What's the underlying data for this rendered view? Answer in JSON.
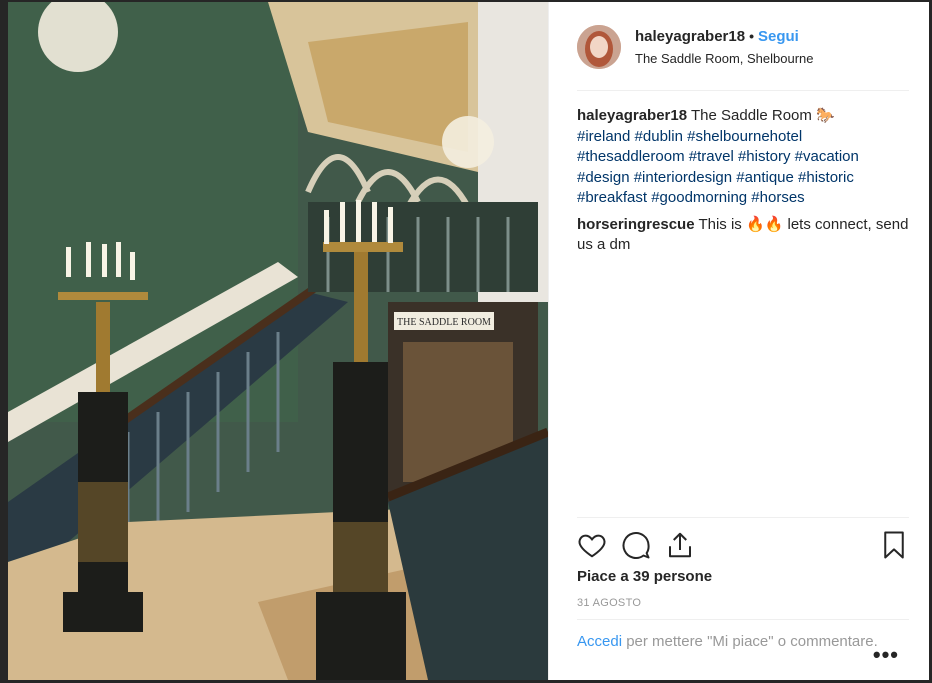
{
  "post": {
    "username": "haleyagraber18",
    "separator": "•",
    "follow_label": "Segui",
    "location": "The Saddle Room, Shelbourne"
  },
  "caption": {
    "user": "haleyagraber18",
    "text": "The Saddle Room",
    "emoji": "🐎",
    "hashtags": [
      "#ireland",
      "#dublin",
      "#shelbournehotel",
      "#thesaddleroom",
      "#travel",
      "#history",
      "#vacation",
      "#design",
      "#interiordesign",
      "#antique",
      "#historic",
      "#breakfast",
      "#goodmorning",
      "#horses"
    ]
  },
  "reply": {
    "user": "horseringrescue",
    "text_before": "This is",
    "emoji": "🔥🔥",
    "text_after": "lets connect, send us a dm"
  },
  "actions": {
    "icons": [
      "heart-icon",
      "comment-icon",
      "share-icon",
      "bookmark-icon"
    ]
  },
  "likes_label": "Piace a 39 persone",
  "date_label": "31 AGOSTO",
  "footer": {
    "login_label": "Accedi",
    "rest": "per mettere \"Mi piace\" o commentare."
  },
  "more_label": "•••",
  "photo_sign": "THE SADDLE ROOM",
  "colors": {
    "link_blue": "#3897f0",
    "hashtag": "#003569",
    "muted": "#999999",
    "wall_green": "#3f5a43"
  }
}
